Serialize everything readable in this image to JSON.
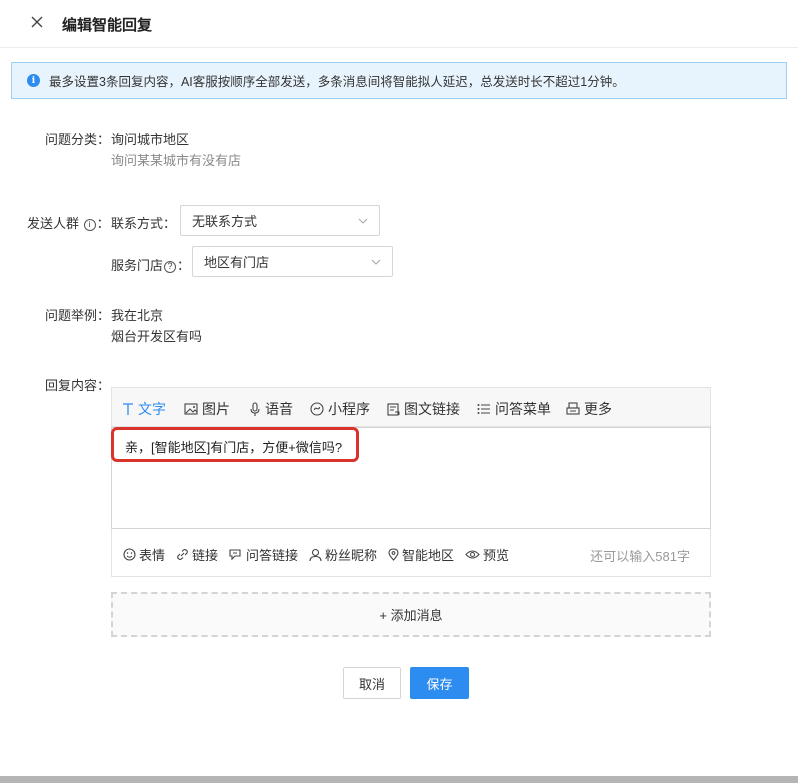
{
  "header": {
    "title": "编辑智能回复"
  },
  "notice": {
    "text": "最多设置3条回复内容，AI客服按顺序全部发送，多条消息间将智能拟人延迟，总发送时长不超过1分钟。"
  },
  "question_category": {
    "label": "问题分类：",
    "value": "询问城市地区",
    "description": "询问某某城市有没有店"
  },
  "audience": {
    "label": "发送人群",
    "label_suffix": "：",
    "contact": {
      "label": "联系方式：",
      "selected": "无联系方式"
    },
    "store": {
      "label_prefix": "服务门店",
      "label_suffix": "：",
      "selected": "地区有门店"
    }
  },
  "examples": {
    "label": "问题举例：",
    "items": [
      "我在北京",
      "烟台开发区有吗"
    ]
  },
  "reply": {
    "label": "回复内容：",
    "tabs": [
      {
        "label": "文字",
        "icon": "text-icon"
      },
      {
        "label": "图片",
        "icon": "image-icon"
      },
      {
        "label": "语音",
        "icon": "microphone-icon"
      },
      {
        "label": "小程序",
        "icon": "mini-program-icon"
      },
      {
        "label": "图文链接",
        "icon": "article-link-icon"
      },
      {
        "label": "问答菜单",
        "icon": "list-menu-icon"
      },
      {
        "label": "更多",
        "icon": "more-icon"
      }
    ],
    "message": "亲，[智能地区]有门店，方便+微信吗?",
    "insert_tools": [
      {
        "label": "表情",
        "icon": "emoji-icon"
      },
      {
        "label": "链接",
        "icon": "link-icon"
      },
      {
        "label": "问答链接",
        "icon": "qa-link-icon"
      },
      {
        "label": "粉丝昵称",
        "icon": "user-icon"
      },
      {
        "label": "智能地区",
        "icon": "location-icon"
      },
      {
        "label": "预览",
        "icon": "eye-icon"
      }
    ],
    "counter": "还可以输入581字"
  },
  "add_message": "+ 添加消息",
  "actions": {
    "cancel": "取消",
    "save": "保存"
  },
  "colors": {
    "accent": "#2d8cf0",
    "highlight": "#d9342b",
    "notice_bg": "#e8f4fd"
  }
}
